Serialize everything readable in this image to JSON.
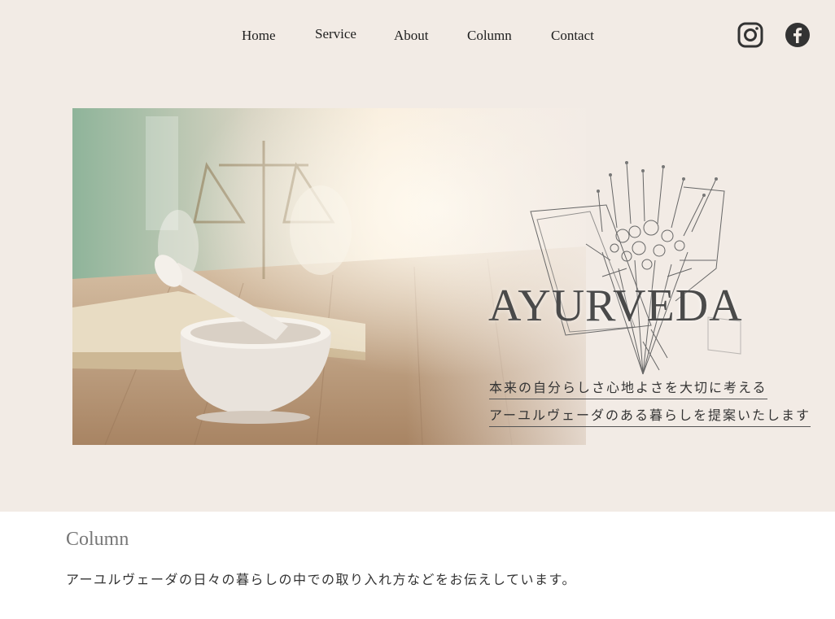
{
  "nav": {
    "items": [
      {
        "label": "Home"
      },
      {
        "label": "Service"
      },
      {
        "label": "About"
      },
      {
        "label": "Column"
      },
      {
        "label": "Contact"
      }
    ]
  },
  "social": {
    "icons": [
      "instagram-icon",
      "facebook-icon"
    ],
    "icon_color": "#333333"
  },
  "hero": {
    "title": "AYURVEDA",
    "tagline_1": "本来の自分らしさ心地よさを大切に考える",
    "tagline_2": "アーユルヴェーダのある暮らしを提案いたします"
  },
  "colors": {
    "header_background": "#f2ebe5",
    "content_background": "#ffffff"
  },
  "column_section": {
    "title": "Column",
    "description": "アーユルヴェーダの日々の暮らしの中での取り入れ方などをお伝えしています。"
  }
}
